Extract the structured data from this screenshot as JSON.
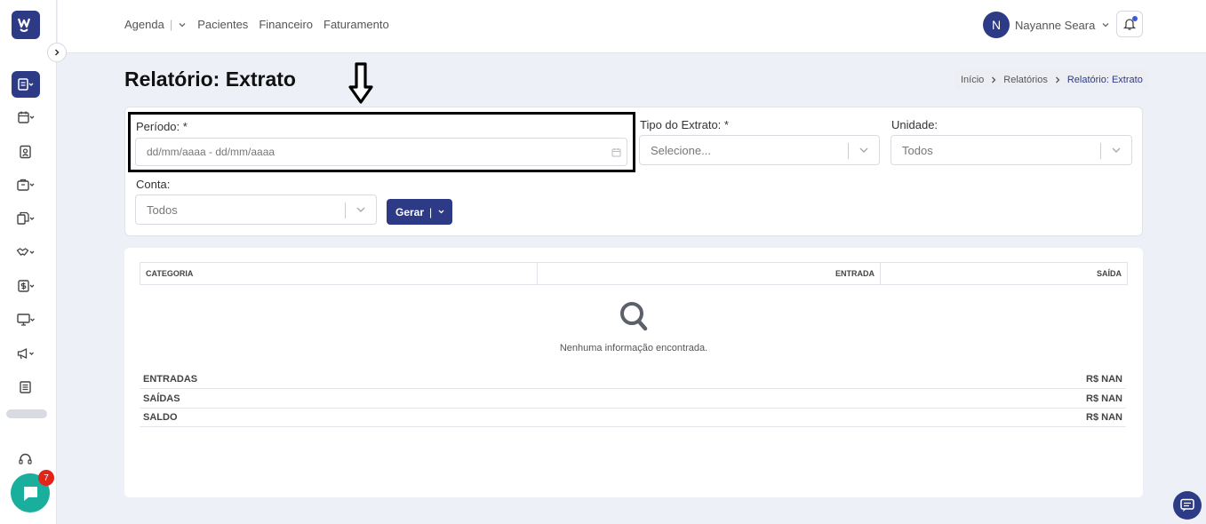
{
  "topnav": {
    "agenda": "Agenda",
    "separator": "|",
    "pacientes": "Pacientes",
    "financeiro": "Financeiro",
    "faturamento": "Faturamento"
  },
  "user": {
    "initial": "N",
    "name": "Nayanne Seara"
  },
  "page": {
    "title": "Relatório: Extrato"
  },
  "breadcrumb": {
    "home": "Início",
    "reports": "Relatórios",
    "current": "Relatório: Extrato"
  },
  "filters": {
    "periodo_label": "Período: *",
    "periodo_placeholder": "dd/mm/aaaa - dd/mm/aaaa",
    "tipo_label": "Tipo do Extrato: *",
    "tipo_value": "Selecione...",
    "unidade_label": "Unidade:",
    "unidade_value": "Todos",
    "conta_label": "Conta:",
    "conta_value": "Todos",
    "gerar_label": "Gerar",
    "gerar_sep": "|"
  },
  "table": {
    "headers": [
      "CATEGORIA",
      "ENTRADA",
      "SAÍDA"
    ],
    "empty_text": "Nenhuma informação encontrada."
  },
  "summary": [
    {
      "label": "ENTRADAS",
      "value": "R$ NAN"
    },
    {
      "label": "SAÍDAS",
      "value": "R$ NAN"
    },
    {
      "label": "SALDO",
      "value": "R$ NAN"
    }
  ],
  "chat": {
    "badge_count": "7"
  },
  "colors": {
    "primary": "#2d3a86",
    "chat": "#1aaf9d",
    "badge": "#e2231a"
  }
}
